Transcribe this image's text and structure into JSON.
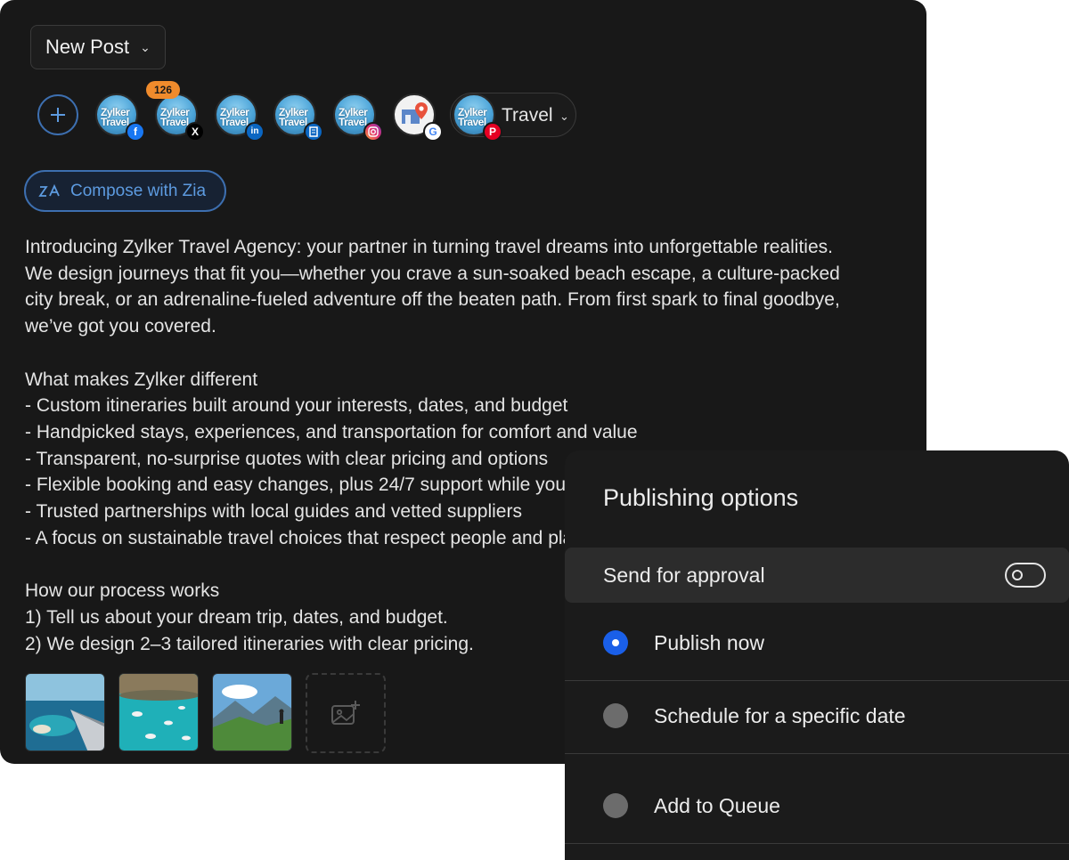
{
  "composer": {
    "new_post_label": "New Post",
    "channel_count_badge": "126",
    "channel_group_label": "Travel",
    "compose_with_zia_label": "Compose with Zia",
    "avatar_text": "Zylker Travel",
    "channels": [
      {
        "network": "facebook",
        "badge_glyph": "f",
        "badge_color": "#1877f2"
      },
      {
        "network": "x",
        "badge_glyph": "𝕏",
        "badge_color": "#000000"
      },
      {
        "network": "linkedin",
        "badge_glyph": "in",
        "badge_color": "#0a66c2"
      },
      {
        "network": "linkedin-page",
        "badge_glyph": "▤",
        "badge_color": "#0a66c2"
      },
      {
        "network": "instagram",
        "badge_glyph": "◎",
        "badge_color": "#e1306c"
      },
      {
        "network": "google-business",
        "badge_glyph": "G",
        "badge_color": "#4285f4"
      },
      {
        "network": "pinterest",
        "badge_glyph": "P",
        "badge_color": "#e60023"
      }
    ],
    "post_text": "Introducing Zylker Travel Agency: your partner in turning travel dreams into unforgettable realities.\nWe design journeys that fit you—whether you crave a sun-soaked beach escape, a culture-packed\ncity break, or an adrenaline-fueled adventure off the beaten path. From first spark to final goodbye,\nwe’ve got you covered.\n\nWhat makes Zylker different\n- Custom itineraries built around your interests, dates, and budget\n- Handpicked stays, experiences, and transportation for comfort and value\n- Transparent, no-surprise quotes with clear pricing and options\n- Flexible booking and easy changes, plus 24/7 support while you travel\n- Trusted partnerships with local guides and vetted suppliers\n- A focus on sustainable travel choices that respect people and places\n\nHow our process works\n1) Tell us about your dream trip, dates, and budget.\n2) We design 2–3 tailored itineraries with clear pricing.",
    "media": [
      {
        "name": "airplane-wing-over-coast",
        "icon": "image"
      },
      {
        "name": "turquoise-bay-boats",
        "icon": "image"
      },
      {
        "name": "mountain-hiker",
        "icon": "image"
      }
    ]
  },
  "publishing": {
    "title": "Publishing options",
    "send_for_approval_label": "Send for approval",
    "send_for_approval_enabled": false,
    "options": [
      {
        "label": "Publish now",
        "selected": true
      },
      {
        "label": "Schedule for a specific date",
        "selected": false
      },
      {
        "label": "Add to Queue",
        "selected": false
      }
    ]
  },
  "colors": {
    "accent_blue": "#1a5fe8",
    "zia_blue": "#5d9be0",
    "badge_orange": "#f08b2c",
    "panel_bg": "#181818"
  }
}
